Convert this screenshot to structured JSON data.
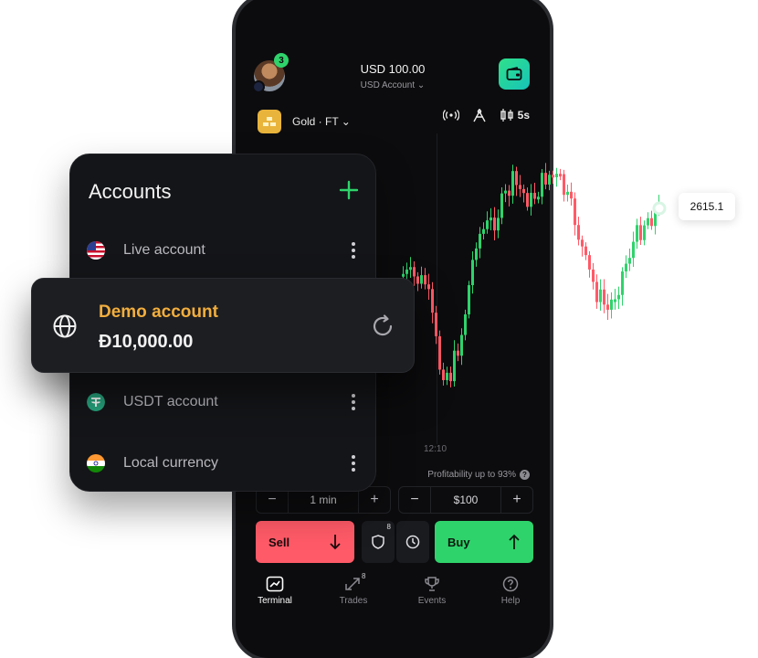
{
  "header": {
    "balance": "USD 100.00",
    "account_type": "USD Account ⌄",
    "notification_count": "3"
  },
  "asset": {
    "name": "Gold · FT ⌄",
    "timeframe": "5s"
  },
  "chart": {
    "time_label": "12:10",
    "current_price": "2615.1",
    "colors": {
      "up": "#2fd36b",
      "down": "#ff5a67"
    }
  },
  "trade": {
    "profitability": "Profitability up to 93%",
    "duration": "1 min",
    "amount": "$100",
    "sell_label": "Sell",
    "buy_label": "Buy",
    "shield_count": "8"
  },
  "tabs": [
    {
      "label": "Terminal",
      "icon": "chart-icon",
      "active": true
    },
    {
      "label": "Trades",
      "icon": "arrows-icon",
      "badge": "8"
    },
    {
      "label": "Events",
      "icon": "trophy-icon"
    },
    {
      "label": "Help",
      "icon": "help-icon"
    }
  ],
  "accounts": {
    "title": "Accounts",
    "items": [
      {
        "name": "Live account",
        "icon": "us-flag-icon"
      },
      {
        "name": "USDT account",
        "icon": "tether-icon"
      },
      {
        "name": "Local currency",
        "icon": "india-flag-icon"
      }
    ],
    "selected": {
      "name": "Demo account",
      "balance": "Đ10,000.00",
      "icon": "globe-icon",
      "accent": "#f2ae3d"
    }
  }
}
